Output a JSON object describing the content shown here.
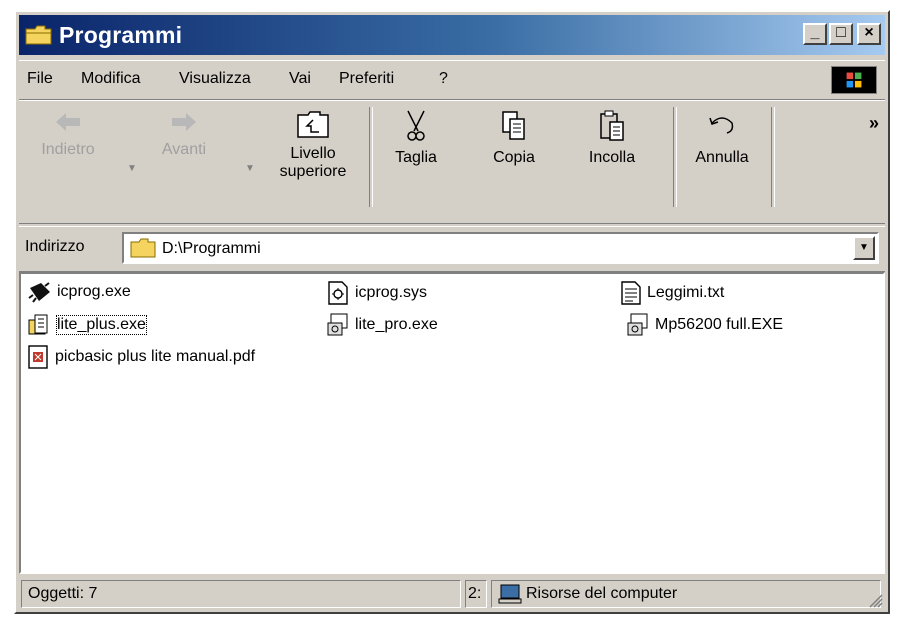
{
  "window": {
    "title": "Programmi",
    "controls": {
      "minimize": "_",
      "maximize": "□",
      "close": "×"
    }
  },
  "menu": {
    "items": [
      {
        "label": "File"
      },
      {
        "label": "Modifica"
      },
      {
        "label": "Visualizza"
      },
      {
        "label": "Vai"
      },
      {
        "label": "Preferiti"
      },
      {
        "label": "?"
      }
    ]
  },
  "toolbar": {
    "back": "Indietro",
    "forward": "Avanti",
    "up_line1": "Livello",
    "up_line2": "superiore",
    "cut": "Taglia",
    "copy": "Copia",
    "paste": "Incolla",
    "undo": "Annulla",
    "more": "»"
  },
  "address": {
    "label": "Indirizzo",
    "value": "D:\\Programmi"
  },
  "files": [
    {
      "name": "icprog.exe",
      "icon": "chip-icon"
    },
    {
      "name": "icprog.sys",
      "icon": "system-file-icon"
    },
    {
      "name": "Leggimi.txt",
      "icon": "text-file-icon"
    },
    {
      "name": "lite_plus.exe",
      "icon": "installer-icon"
    },
    {
      "name": "lite_pro.exe",
      "icon": "setup-icon"
    },
    {
      "name": "Mp56200 full.EXE",
      "icon": "setup-icon"
    },
    {
      "name": "picbasic plus lite manual.pdf",
      "icon": "pdf-icon"
    }
  ],
  "status": {
    "objects": "Oggetti: 7",
    "size": "2:",
    "location": "Risorse del computer"
  },
  "colors": {
    "title_start": "#0a246a",
    "title_end": "#a6caf0",
    "chrome": "#d4d0c8"
  }
}
